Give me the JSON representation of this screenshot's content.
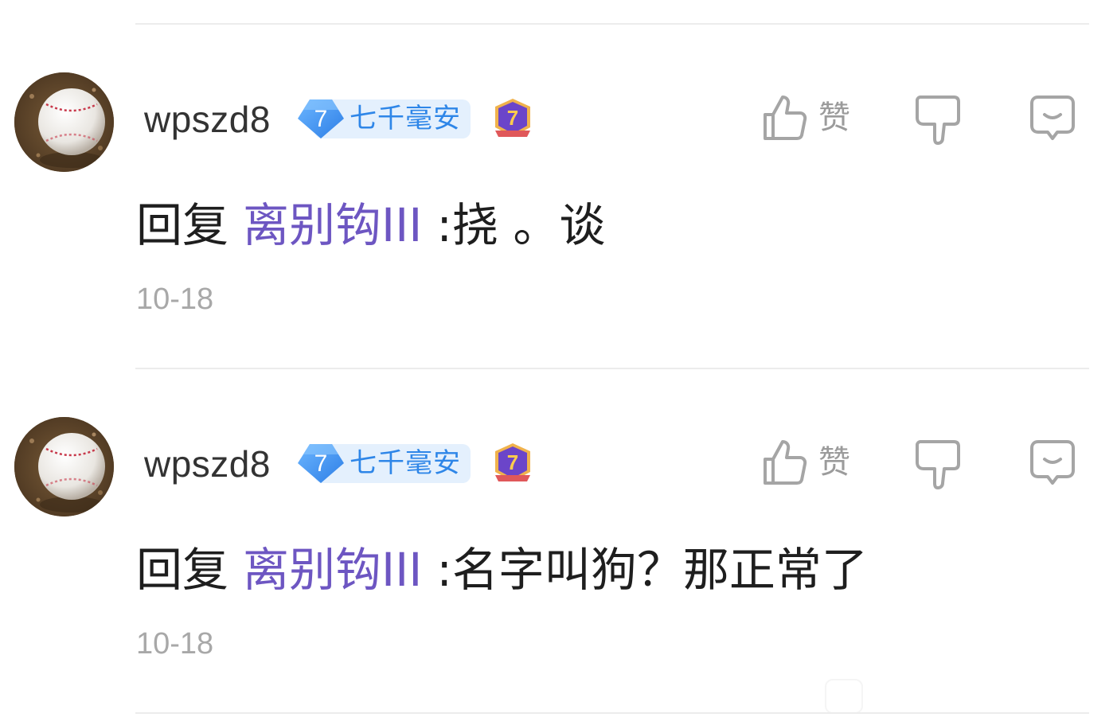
{
  "comments": [
    {
      "username": "wpszd8",
      "level_number": "7",
      "level_title": "七千毫安",
      "medal_number": "7",
      "like_label": "赞",
      "reply_prefix": "回复",
      "mention": "离别钩III",
      "content": ":挠 。谈",
      "date": "10-18"
    },
    {
      "username": "wpszd8",
      "level_number": "7",
      "level_title": "七千毫安",
      "medal_number": "7",
      "like_label": "赞",
      "reply_prefix": "回复",
      "mention": "离别钩III",
      "content": ":名字叫狗？那正常了",
      "date": "10-18"
    }
  ],
  "colors": {
    "username": "#333333",
    "mention": "#6d56c2",
    "level_title": "#2e86e8",
    "level_pill_bg": "#e4f0fd",
    "action_icon": "#9b9b9b",
    "date": "#a8a8a8",
    "divider": "#ececec"
  },
  "icons": {
    "like": "thumbs-up-icon",
    "dislike": "thumbs-down-icon",
    "reply": "chat-bubble-icon",
    "level": "diamond-badge-icon",
    "medal": "medal-icon"
  }
}
